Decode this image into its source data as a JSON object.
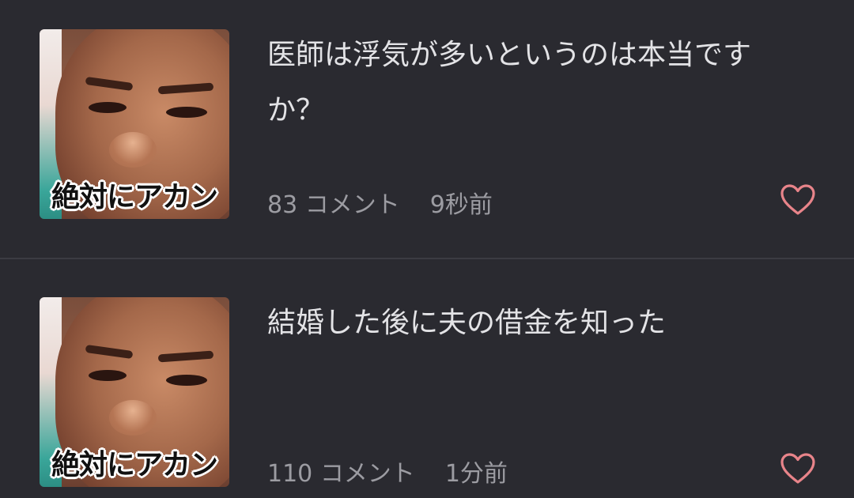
{
  "posts": [
    {
      "thumbnail_caption": "絶対にアカン",
      "title": "医師は浮気が多いというのは本当ですか？",
      "comment_count": "83",
      "comment_label": "コメント",
      "time_ago": "9秒前",
      "like_icon": "heart-outline-icon"
    },
    {
      "thumbnail_caption": "絶対にアカン",
      "title": "結婚した後に夫の借金を知った",
      "comment_count": "110",
      "comment_label": "コメント",
      "time_ago": "1分前",
      "like_icon": "heart-outline-icon"
    }
  ],
  "colors": {
    "background": "#2a2a30",
    "title_text": "#e3e3e6",
    "meta_text": "#9c9ca2",
    "heart": "#e8848a",
    "divider": "#3b3b42"
  }
}
